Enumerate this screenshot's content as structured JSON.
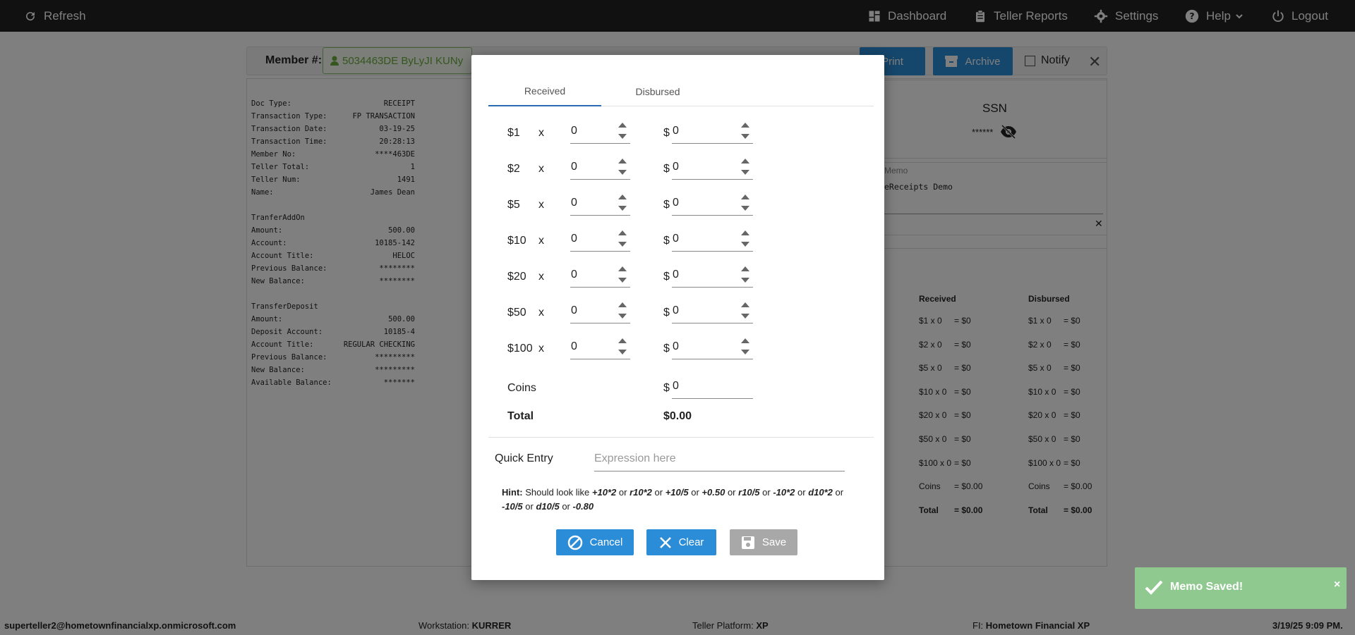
{
  "topbar": {
    "refresh": "Refresh",
    "dashboard": "Dashboard",
    "teller_reports": "Teller Reports",
    "settings": "Settings",
    "help": "Help",
    "logout": "Logout"
  },
  "toolbar": {
    "member_label": "Member #:",
    "member_value": "5034463DE ByLyJI KUNy",
    "print": "Print",
    "archive": "Archive",
    "notify": "Notify"
  },
  "receipt": [
    {
      "k": "Doc Type:",
      "v": "RECEIPT"
    },
    {
      "k": "Transaction Type:",
      "v": "FP TRANSACTION"
    },
    {
      "k": "Transaction Date:",
      "v": "03-19-25"
    },
    {
      "k": "Transaction Time:",
      "v": "20:28:13"
    },
    {
      "k": "Member No:",
      "v": "****463DE"
    },
    {
      "k": "Teller Total:",
      "v": "1"
    },
    {
      "k": "Teller Num:",
      "v": "1491"
    },
    {
      "k": "Name:",
      "v": "James Dean"
    },
    {
      "k": "",
      "v": ""
    },
    {
      "k": "TranferAddOn",
      "v": ""
    },
    {
      "k": "Amount:",
      "v": "500.00"
    },
    {
      "k": "Account:",
      "v": "10185-142"
    },
    {
      "k": "Account Title:",
      "v": "HELOC"
    },
    {
      "k": "Previous Balance:",
      "v": "********"
    },
    {
      "k": "New Balance:",
      "v": "********"
    },
    {
      "k": "",
      "v": ""
    },
    {
      "k": "TransferDeposit",
      "v": ""
    },
    {
      "k": "Amount:",
      "v": "500.00"
    },
    {
      "k": "Deposit Account:",
      "v": "10185-4"
    },
    {
      "k": "Account Title:",
      "v": "REGULAR CHECKING"
    },
    {
      "k": "Previous Balance:",
      "v": "*********"
    },
    {
      "k": "New Balance:",
      "v": "*********"
    },
    {
      "k": "Available Balance:",
      "v": "*******"
    }
  ],
  "ssn": {
    "title": "SSN",
    "masked": "******"
  },
  "memo": {
    "label": "Memo",
    "text": "eReceipts Demo"
  },
  "summary": {
    "received_header": "Received",
    "disbursed_header": "Disbursed",
    "rows": [
      {
        "r": "$1 x 0",
        "rv": "= $0",
        "d": "$1 x 0",
        "dv": "= $0"
      },
      {
        "r": "$2 x 0",
        "rv": "= $0",
        "d": "$2 x 0",
        "dv": "= $0"
      },
      {
        "r": "$5 x 0",
        "rv": "= $0",
        "d": "$5 x 0",
        "dv": "= $0"
      },
      {
        "r": "$10 x 0",
        "rv": "= $0",
        "d": "$10 x 0",
        "dv": "= $0"
      },
      {
        "r": "$20 x 0",
        "rv": "= $0",
        "d": "$20 x 0",
        "dv": "= $0"
      },
      {
        "r": "$50 x 0",
        "rv": "= $0",
        "d": "$50 x 0",
        "dv": "= $0"
      },
      {
        "r": "$100 x 0",
        "rv": "= $0",
        "d": "$100 x 0",
        "dv": "= $0"
      },
      {
        "r": "Coins",
        "rv": "= $0.00",
        "d": "Coins",
        "dv": "= $0.00"
      },
      {
        "r": "Total",
        "rv": "= $0.00",
        "d": "Total",
        "dv": "= $0.00"
      }
    ]
  },
  "modal": {
    "tab_received": "Received",
    "tab_disbursed": "Disbursed",
    "x_symbol": "x",
    "dollar_symbol": "$",
    "denominations": [
      {
        "label": "$1",
        "count": "0",
        "amount": "0"
      },
      {
        "label": "$2",
        "count": "0",
        "amount": "0"
      },
      {
        "label": "$5",
        "count": "0",
        "amount": "0"
      },
      {
        "label": "$10",
        "count": "0",
        "amount": "0"
      },
      {
        "label": "$20",
        "count": "0",
        "amount": "0"
      },
      {
        "label": "$50",
        "count": "0",
        "amount": "0"
      },
      {
        "label": "$100",
        "count": "0",
        "amount": "0"
      }
    ],
    "coins_label": "Coins",
    "coins_value": "0",
    "total_label": "Total",
    "total_value": "$0.00",
    "quick_entry_label": "Quick Entry",
    "quick_entry_placeholder": "Expression here",
    "hint_label": "Hint:",
    "hint_text": "Should look like",
    "hint_examples": [
      "+10*2",
      "r10*2",
      "+10/5",
      "+0.50",
      "r10/5",
      "-10*2",
      "d10*2",
      "-10/5",
      "d10/5",
      "-0.80"
    ],
    "hint_or": "or",
    "cancel": "Cancel",
    "clear": "Clear",
    "save": "Save"
  },
  "toast": {
    "message": "Memo Saved!",
    "close": "×"
  },
  "status": {
    "user": "superteller2@hometownfinancialxp.onmicrosoft.com",
    "workstation_label": "Workstation:",
    "workstation": "KURRER",
    "platform_label": "Teller Platform:",
    "platform": "XP",
    "fi_label": "FI:",
    "fi": "Hometown Financial XP",
    "datetime": "3/19/25 9:09 PM."
  },
  "colors": {
    "primary": "#2b8cd8",
    "topbar": "#222222",
    "success": "#8fc98f",
    "member": "#6aac3b"
  }
}
